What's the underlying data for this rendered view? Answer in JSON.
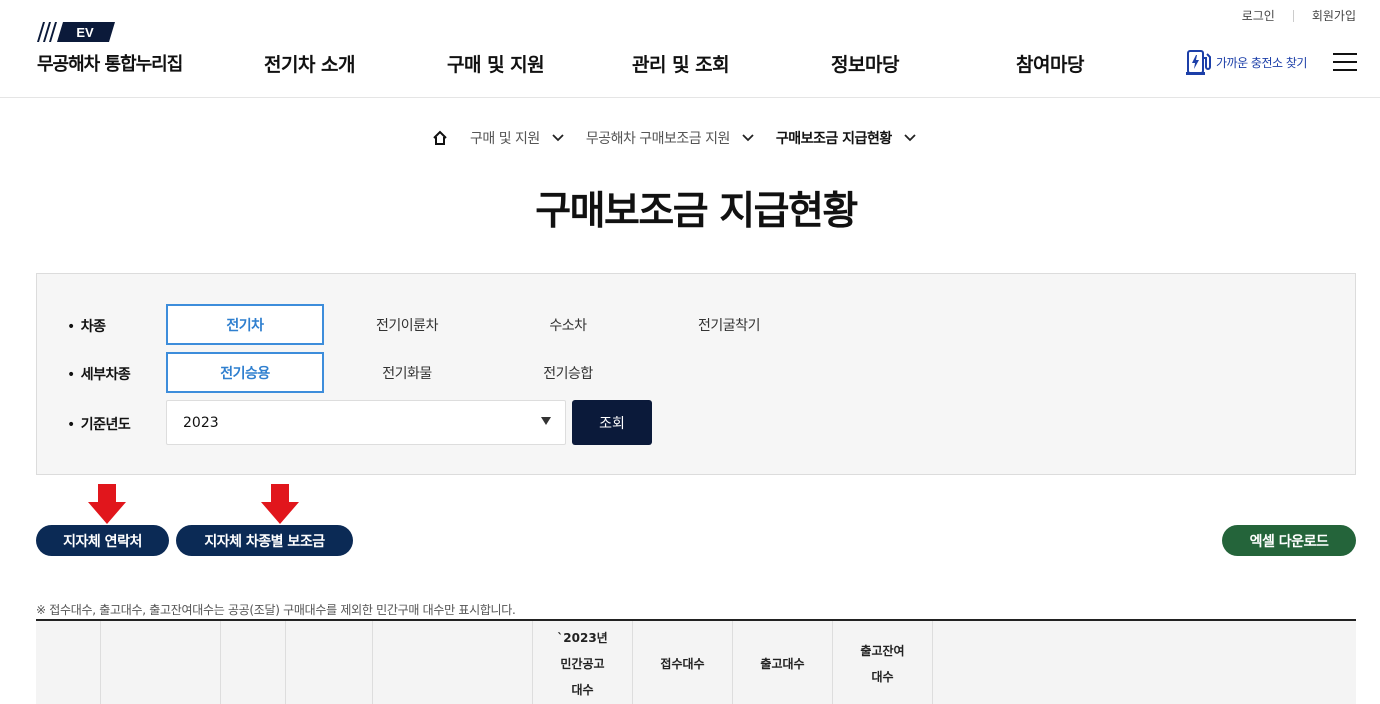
{
  "header": {
    "util": {
      "login": "로그인",
      "signup": "회원가입"
    },
    "logo_text": "EV",
    "site_name": "무공해차 통합누리집",
    "menus": [
      "전기차 소개",
      "구매 및 지원",
      "관리 및 조회",
      "정보마당",
      "참여마당"
    ],
    "charge_link": "가까운 충전소 찾기",
    "accent": "#1c3fa8"
  },
  "breadcrumb": {
    "items": [
      "구매 및 지원",
      "무공해차 구매보조금 지원",
      "구매보조금 지급현황"
    ]
  },
  "page_title": "구매보조금 지급현황",
  "filters": {
    "car_type": {
      "label": "차종",
      "options": [
        "전기차",
        "전기이륜차",
        "수소차",
        "전기굴착기"
      ],
      "selected": "전기차"
    },
    "sub_type": {
      "label": "세부차종",
      "options": [
        "전기승용",
        "전기화물",
        "전기승합"
      ],
      "selected": "전기승용"
    },
    "year": {
      "label": "기준년도",
      "value": "2023"
    },
    "search_label": "조회",
    "active_color": "#3d8ddb"
  },
  "actions": {
    "contact": "지자체 연락처",
    "subsidy": "지자체 차종별 보조금",
    "excel": "엑셀 다운로드"
  },
  "notice": "※ 접수대수, 출고대수, 출고잔여대수는 공공(조달) 구매대수를 제외한 민간구매 대수만 표시합니다.",
  "table": {
    "headers": [
      "",
      "",
      "",
      "",
      "",
      "`2023년\n민간공고\n대수",
      "접수대수",
      "출고대수",
      "출고잔여\n대수",
      ""
    ]
  }
}
